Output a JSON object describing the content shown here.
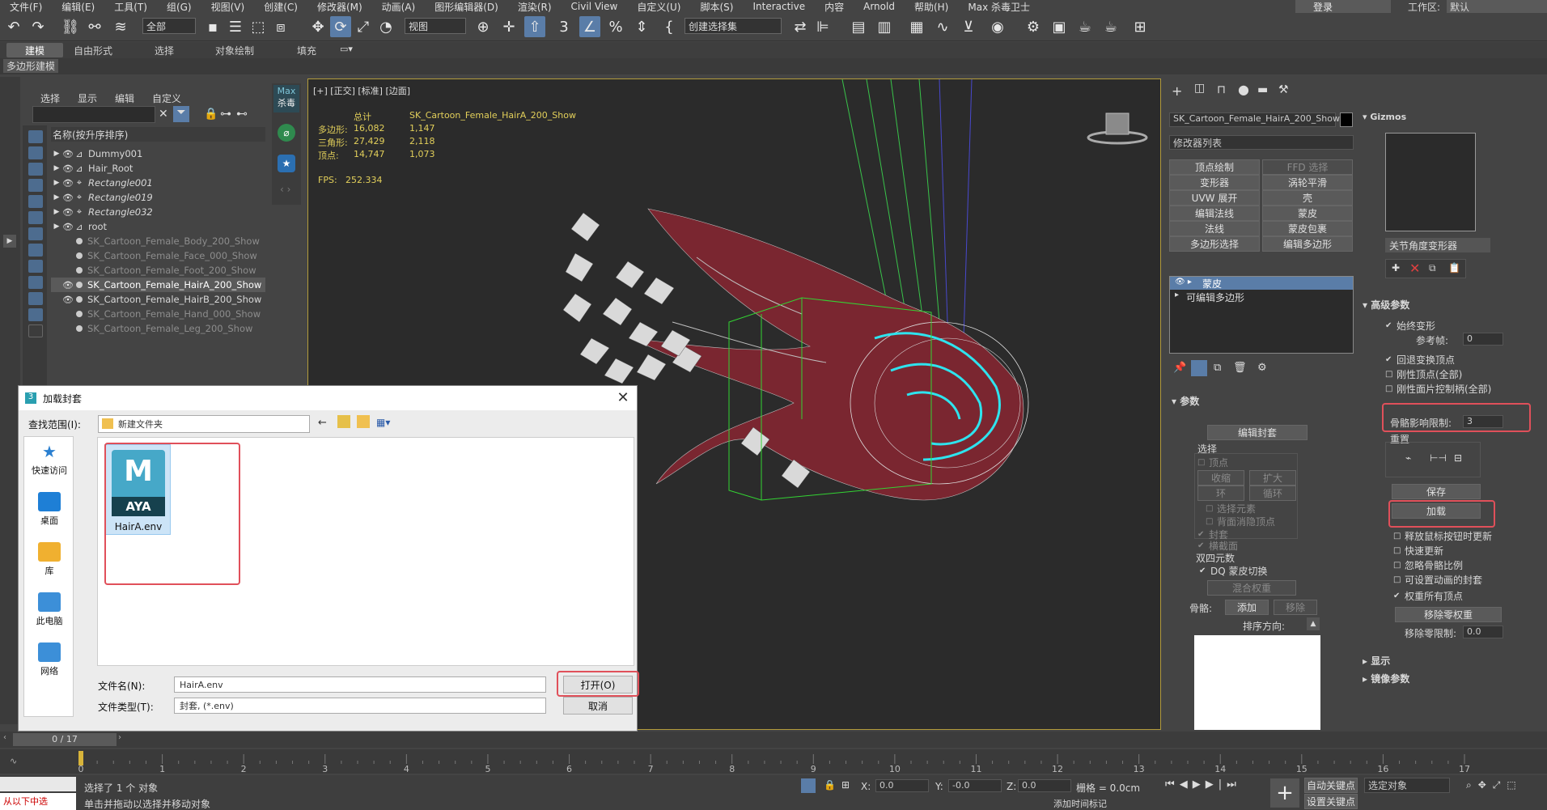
{
  "menu": [
    "文件(F)",
    "编辑(E)",
    "工具(T)",
    "组(G)",
    "视图(V)",
    "创建(C)",
    "修改器(M)",
    "动画(A)",
    "图形编辑器(D)",
    "渲染(R)",
    "Civil View",
    "自定义(U)",
    "脚本(S)",
    "Interactive",
    "内容",
    "Arnold",
    "帮助(H)",
    "Max 杀毒卫士"
  ],
  "login": "登录",
  "workspace": {
    "label": "工作区:",
    "value": "默认"
  },
  "toolbar": {
    "filter_all": "全部",
    "view": "视图",
    "selection_set": "创建选择集"
  },
  "ribbon": {
    "tabs": [
      "建模",
      "自由形式",
      "选择",
      "对象绘制",
      "填充"
    ],
    "sub": "多边形建模"
  },
  "scene": {
    "menu": [
      "选择",
      "显示",
      "编辑",
      "自定义"
    ],
    "header": "名称(按升序排序)",
    "rows": [
      {
        "name": "Dummy001",
        "style": "normal"
      },
      {
        "name": "Hair_Root",
        "style": "normal"
      },
      {
        "name": "Rectangle001",
        "style": "italic"
      },
      {
        "name": "Rectangle019",
        "style": "italic"
      },
      {
        "name": "Rectangle032",
        "style": "italic"
      },
      {
        "name": "root",
        "style": "normal"
      },
      {
        "name": "SK_Cartoon_Female_Body_200_Show",
        "style": "dim"
      },
      {
        "name": "SK_Cartoon_Female_Face_000_Show",
        "style": "dim"
      },
      {
        "name": "SK_Cartoon_Female_Foot_200_Show",
        "style": "dim"
      },
      {
        "name": "SK_Cartoon_Female_HairA_200_Show",
        "style": "selected"
      },
      {
        "name": "SK_Cartoon_Female_HairB_200_Show",
        "style": "normal"
      },
      {
        "name": "SK_Cartoon_Female_Hand_000_Show",
        "style": "dim"
      },
      {
        "name": "SK_Cartoon_Female_Leg_200_Show",
        "style": "dim"
      }
    ]
  },
  "plugin": {
    "title": "Max",
    "subtitle": "杀毒"
  },
  "viewport": {
    "label": "[+] [正交] [标准] [边面]",
    "stats": {
      "col_total": "总计",
      "object": "SK_Cartoon_Female_HairA_200_Show",
      "rows": [
        {
          "label": "多边形:",
          "total": "16,082",
          "sel": "1,147"
        },
        {
          "label": "三角形:",
          "total": "27,429",
          "sel": "2,118"
        },
        {
          "label": "顶点:",
          "total": "14,747",
          "sel": "1,073"
        }
      ],
      "fps_label": "FPS:",
      "fps": "252.334"
    }
  },
  "command": {
    "object_name": "SK_Cartoon_Female_HairA_200_Show",
    "modifier_list": "修改器列表",
    "modifier_buttons": [
      [
        "顶点绘制",
        "FFD 选择"
      ],
      [
        "变形器",
        "涡轮平滑"
      ],
      [
        "UVW 展开",
        "壳"
      ],
      [
        "编辑法线",
        "蒙皮"
      ],
      [
        "法线",
        "蒙皮包裹"
      ],
      [
        "多边形选择",
        "编辑多边形"
      ]
    ],
    "stack": [
      "蒙皮",
      "可编辑多边形"
    ],
    "params_title": "参数",
    "edit_envelope": "编辑封套",
    "select_title": "选择",
    "vertex": "顶点",
    "shrink": "收缩",
    "grow": "扩大",
    "ring": "环",
    "loop": "循环",
    "select_element": "选择元素",
    "backface": "背面消隐顶点",
    "envelope": "封套",
    "cross_section": "横截面",
    "dq_title": "双四元数",
    "dq_toggle": "DQ 蒙皮切换",
    "blend_weight": "混合权重",
    "bones_label": "骨骼:",
    "add": "添加",
    "remove": "移除",
    "sort_label": "排序方向:"
  },
  "gizmo": {
    "title": "Gizmos",
    "deformer": "关节角度变形器",
    "advanced_title": "高级参数",
    "always_deform": "始终变形",
    "ref_frame_label": "参考帧:",
    "ref_frame": "0",
    "back_transform": "回退变换顶点",
    "rigid_vertices": "刚性顶点(全部)",
    "rigid_patch": "刚性面片控制柄(全部)",
    "bone_limit_label": "骨骼影响限制:",
    "bone_limit": "3",
    "reset_label": "重置",
    "save": "保存",
    "load": "加载",
    "release_mouse": "释放鼠标按钮时更新",
    "fast_update": "快速更新",
    "ignore_scale": "忽略骨骼比例",
    "animatable_env": "可设置动画的封套",
    "weight_all": "权重所有顶点",
    "remove_zero": "移除零权重",
    "remove_zero_limit_label": "移除零限制:",
    "remove_zero_limit": "0.0",
    "display": "显示",
    "mirror": "镜像参数"
  },
  "dialog": {
    "title": "加载封套",
    "lookin_label": "查找范围(I):",
    "lookin_value": "新建文件夹",
    "places": [
      "快速访问",
      "桌面",
      "库",
      "此电脑",
      "网络"
    ],
    "file": {
      "name": "HairA.env",
      "icon_letters": "M",
      "icon_sub": "AYA"
    },
    "filename_label": "文件名(N):",
    "filename_value": "HairA.env",
    "filetype_label": "文件类型(T):",
    "filetype_value": "封套, (*.env)",
    "open": "打开(O)",
    "cancel": "取消"
  },
  "timeline": {
    "frame": "0 / 17",
    "ticks": [
      "0",
      "1",
      "2",
      "3",
      "4",
      "5",
      "6",
      "7",
      "8",
      "9",
      "10",
      "11",
      "12",
      "13",
      "14",
      "15",
      "16",
      "17"
    ]
  },
  "status": {
    "selected": "选择了 1 个 对象",
    "hint": "单击并拖动以选择并移动对象",
    "x_label": "X:",
    "x": "0.0",
    "y_label": "Y:",
    "y": "-0.0",
    "z_label": "Z:",
    "z": "0.0",
    "grid": "栅格 = 0.0cm",
    "auto_key": "自动关键点",
    "set_key": "设置关键点",
    "selected_obj": "选定对象",
    "add_time_tag": "添加时间标记",
    "bottom_note": "从以下中选"
  },
  "colors": {
    "accent": "#5a7da8",
    "highlight_box": "#e0505a",
    "viewport_border": "#b29b3c",
    "stat_text": "#e2cf5a"
  }
}
